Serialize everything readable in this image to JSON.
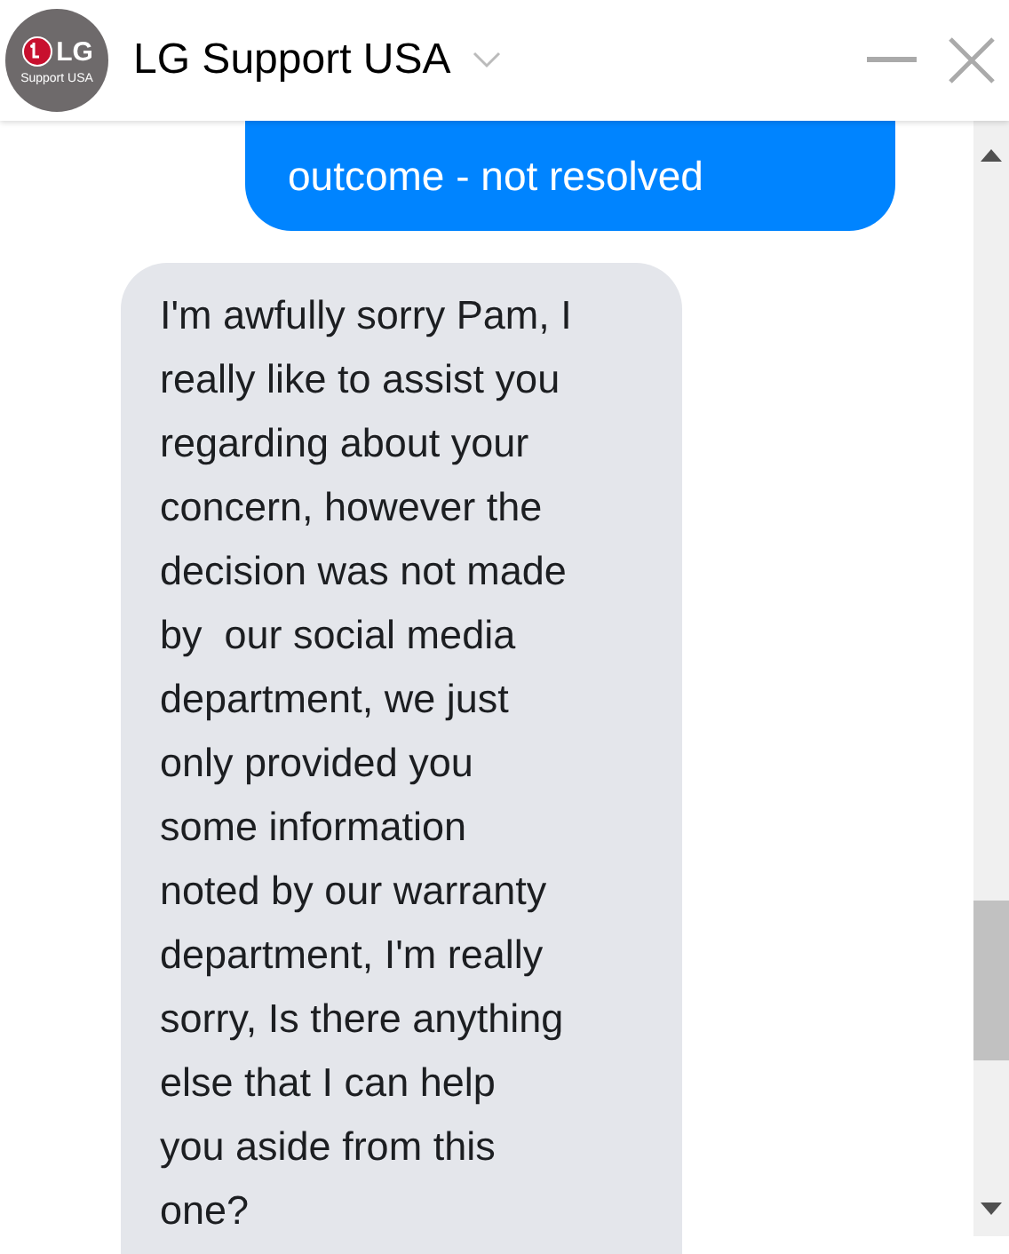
{
  "header": {
    "avatar_lines": [
      "LG",
      "Support USA"
    ],
    "title": "LG Support USA"
  },
  "messages": [
    {
      "kind": "sent",
      "text": "outcome - not resolved"
    },
    {
      "kind": "received",
      "text": "I'm awfully sorry Pam, I\nreally like to assist you\nregarding about your\nconcern, however the\ndecision was not made\nby  our social media\ndepartment, we just\nonly provided you\nsome information\nnoted by our warranty\ndepartment, I'm really\nsorry, Is there anything\nelse that I can help\nyou aside from this\none?"
    }
  ]
}
